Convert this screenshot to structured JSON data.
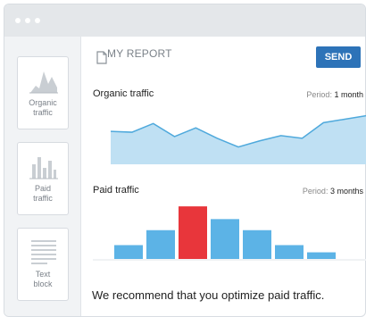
{
  "window": {
    "controls": [
      "dot",
      "dot",
      "dot"
    ]
  },
  "sidebar": {
    "items": [
      {
        "label": "Organic\ntraffic",
        "icon": "area-chart-icon"
      },
      {
        "label": "Paid\ntraffic",
        "icon": "bar-chart-icon"
      },
      {
        "label": "Text\nblock",
        "icon": "text-lines-icon"
      }
    ]
  },
  "report": {
    "title": "MY REPORT",
    "send_label": "SEND"
  },
  "organic": {
    "title": "Organic traffic",
    "period_label": "Period:",
    "period_value": "1 month",
    "color": "#bfe0f3",
    "line_color": "#4fa9dc"
  },
  "paid": {
    "title": "Paid traffic",
    "period_label": "Period:",
    "period_value": "3 months",
    "bar_color": "#5cb3e6",
    "highlight_color": "#e8363b"
  },
  "recommendation": "We recommend that you optimize paid traffic.",
  "chart_data": [
    {
      "type": "area",
      "title": "Organic traffic",
      "x": [
        1,
        2,
        3,
        4,
        5,
        6,
        7,
        8,
        9,
        10,
        11,
        12,
        13
      ],
      "values": [
        38,
        37,
        47,
        32,
        42,
        30,
        20,
        27,
        33,
        30,
        48,
        52,
        56
      ],
      "ylim": [
        0,
        70
      ]
    },
    {
      "type": "bar",
      "title": "Paid traffic",
      "categories": [
        "1",
        "2",
        "3",
        "4",
        "5",
        "6",
        "7"
      ],
      "values": [
        25,
        52,
        95,
        72,
        52,
        25,
        12
      ],
      "highlight_index": 2,
      "ylim": [
        0,
        100
      ]
    }
  ]
}
